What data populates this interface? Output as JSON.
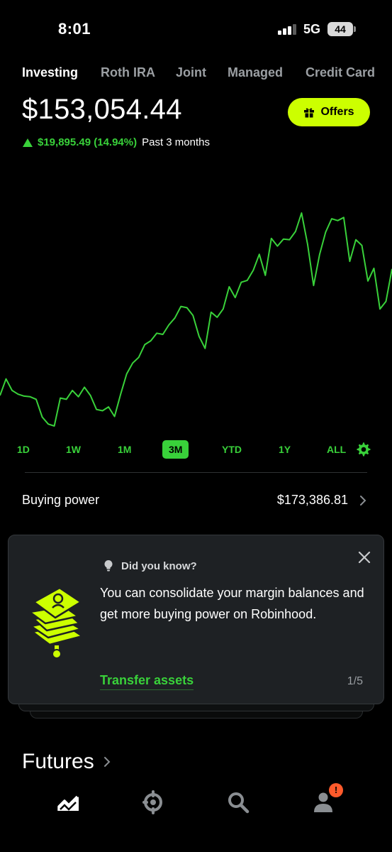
{
  "status_bar": {
    "time": "8:01",
    "network": "5G",
    "battery": "44"
  },
  "tabs": [
    {
      "label": "Investing",
      "active": true
    },
    {
      "label": "Roth IRA",
      "active": false
    },
    {
      "label": "Joint",
      "active": false
    },
    {
      "label": "Managed",
      "active": false
    },
    {
      "label": "Credit Card",
      "active": false
    }
  ],
  "portfolio": {
    "value": "$153,054.44",
    "change": "$19,895.49 (14.94%)",
    "period": "Past 3 months"
  },
  "offers_button": {
    "label": "Offers"
  },
  "chart_data": {
    "type": "line",
    "series": [
      {
        "values": [
          7.8,
          10.4,
          8.6,
          8.0,
          7.7,
          7.6,
          7.2,
          4.4,
          3.3,
          3.0,
          7.4,
          7.2,
          8.6,
          7.6,
          9.1,
          7.8,
          5.6,
          5.4,
          6.0,
          4.5,
          8.0,
          11.2,
          12.9,
          13.8,
          15.8,
          16.4,
          17.6,
          17.4,
          18.9,
          20.0,
          21.8,
          21.6,
          20.4,
          17.1,
          15.2,
          20.9,
          20.1,
          21.4,
          24.9,
          23.2,
          25.6,
          25.9,
          27.5,
          30.0,
          26.7,
          32.5,
          31.3,
          32.4,
          32.3,
          33.6,
          36.5,
          31.6,
          25.1,
          30.0,
          33.5,
          35.6,
          35.3,
          35.8,
          28.9,
          32.3,
          31.4,
          25.8,
          27.8,
          21.4,
          22.6,
          27.7
        ]
      }
    ],
    "color": "#39d13a"
  },
  "ranges": [
    {
      "label": "1D",
      "active": false
    },
    {
      "label": "1W",
      "active": false
    },
    {
      "label": "1M",
      "active": false
    },
    {
      "label": "3M",
      "active": true
    },
    {
      "label": "YTD",
      "active": false
    },
    {
      "label": "1Y",
      "active": false
    },
    {
      "label": "ALL",
      "active": false
    }
  ],
  "buying_power": {
    "label": "Buying power",
    "value": "$173,386.81"
  },
  "card": {
    "heading": "Did you know?",
    "body": "You can consolidate your margin balances and get more buying power on Robinhood.",
    "link": "Transfer assets",
    "page": "1/5"
  },
  "futures": {
    "label": "Futures"
  },
  "nav": {
    "items": [
      "investing-icon",
      "crypto-icon",
      "search-icon",
      "account-icon"
    ],
    "badge": "!"
  },
  "colors": {
    "accent": "#39d13a",
    "offers": "#ccff00",
    "badge": "#ff5a2b"
  }
}
